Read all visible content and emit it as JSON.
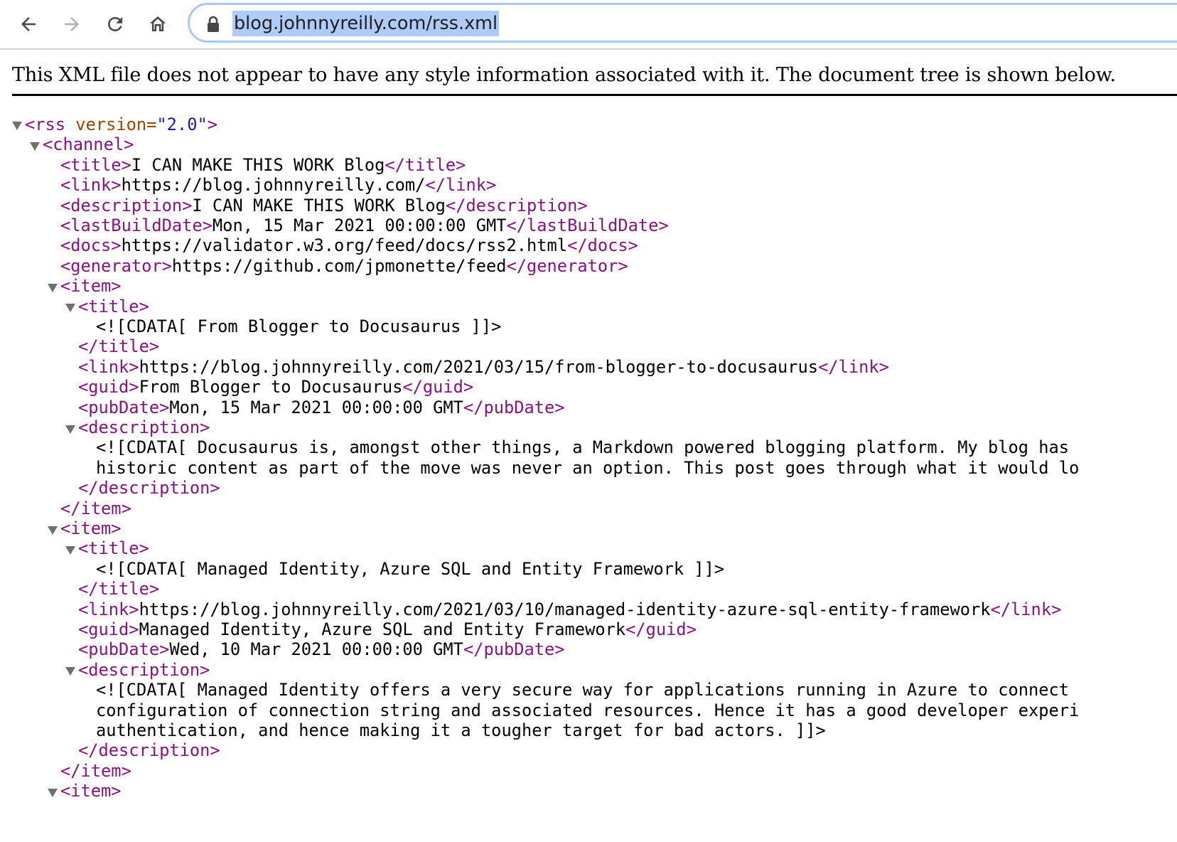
{
  "browser": {
    "url": "blog.johnnyreilly.com/rss.xml",
    "icons": {
      "back": "arrow-left-icon",
      "forward": "arrow-right-icon",
      "reload": "reload-icon",
      "home": "home-icon",
      "lock": "lock-icon"
    },
    "colors": {
      "omnibox_border": "#a8c7fa",
      "url_selection": "#aecbfa",
      "forward_disabled": "#b0b0b0"
    }
  },
  "xml_viewer": {
    "notice": "This XML file does not appear to have any style information associated with it. The document tree is shown below.",
    "colors": {
      "tag": "#881280",
      "attribute_name": "#994500",
      "attribute_value": "#1a1aa6",
      "toggle": "#707070"
    },
    "rss": {
      "open_name": "<rss",
      "attr_name": " version=",
      "attr_value": "\"2.0\"",
      "open_close": ">"
    },
    "channel": {
      "open": "<channel>",
      "fields": [
        {
          "open": "<title>",
          "value": "I CAN MAKE THIS WORK Blog",
          "close": "</title>"
        },
        {
          "open": "<link>",
          "value": "https://blog.johnnyreilly.com/",
          "close": "</link>"
        },
        {
          "open": "<description>",
          "value": "I CAN MAKE THIS WORK Blog",
          "close": "</description>"
        },
        {
          "open": "<lastBuildDate>",
          "value": "Mon, 15 Mar 2021 00:00:00 GMT",
          "close": "</lastBuildDate>"
        },
        {
          "open": "<docs>",
          "value": "https://validator.w3.org/feed/docs/rss2.html",
          "close": "</docs>"
        },
        {
          "open": "<generator>",
          "value": "https://github.com/jpmonette/feed",
          "close": "</generator>"
        }
      ]
    },
    "items": [
      {
        "open": "<item>",
        "title_open": "<title>",
        "title_value": "<![CDATA[ From Blogger to Docusaurus ]]>",
        "title_close": "</title>",
        "link_open": "<link>",
        "link_value": "https://blog.johnnyreilly.com/2021/03/15/from-blogger-to-docusaurus",
        "link_close": "</link>",
        "guid_open": "<guid>",
        "guid_value": "From Blogger to Docusaurus",
        "guid_close": "</guid>",
        "pubdate_open": "<pubDate>",
        "pubdate_value": "Mon, 15 Mar 2021 00:00:00 GMT",
        "pubdate_close": "</pubDate>",
        "desc_open": "<description>",
        "desc_lines": [
          "<![CDATA[ Docusaurus is, amongst other things, a Markdown powered blogging platform. My blog has",
          "historic content as part of the move was never an option. This post goes through what it would lo"
        ],
        "desc_close": "</description>",
        "close": "</item>"
      },
      {
        "open": "<item>",
        "title_open": "<title>",
        "title_value": "<![CDATA[ Managed Identity, Azure SQL and Entity Framework ]]>",
        "title_close": "</title>",
        "link_open": "<link>",
        "link_value": "https://blog.johnnyreilly.com/2021/03/10/managed-identity-azure-sql-entity-framework",
        "link_close": "</link>",
        "guid_open": "<guid>",
        "guid_value": "Managed Identity, Azure SQL and Entity Framework",
        "guid_close": "</guid>",
        "pubdate_open": "<pubDate>",
        "pubdate_value": "Wed, 10 Mar 2021 00:00:00 GMT",
        "pubdate_close": "</pubDate>",
        "desc_open": "<description>",
        "desc_lines": [
          "<![CDATA[ Managed Identity offers a very secure way for applications running in Azure to connect",
          "configuration of connection string and associated resources. Hence it has a good developer experi",
          "authentication, and hence making it a tougher target for bad actors. ]]>"
        ],
        "desc_close": "</description>",
        "close": "</item>"
      }
    ],
    "partial_item_open": "<item>"
  }
}
